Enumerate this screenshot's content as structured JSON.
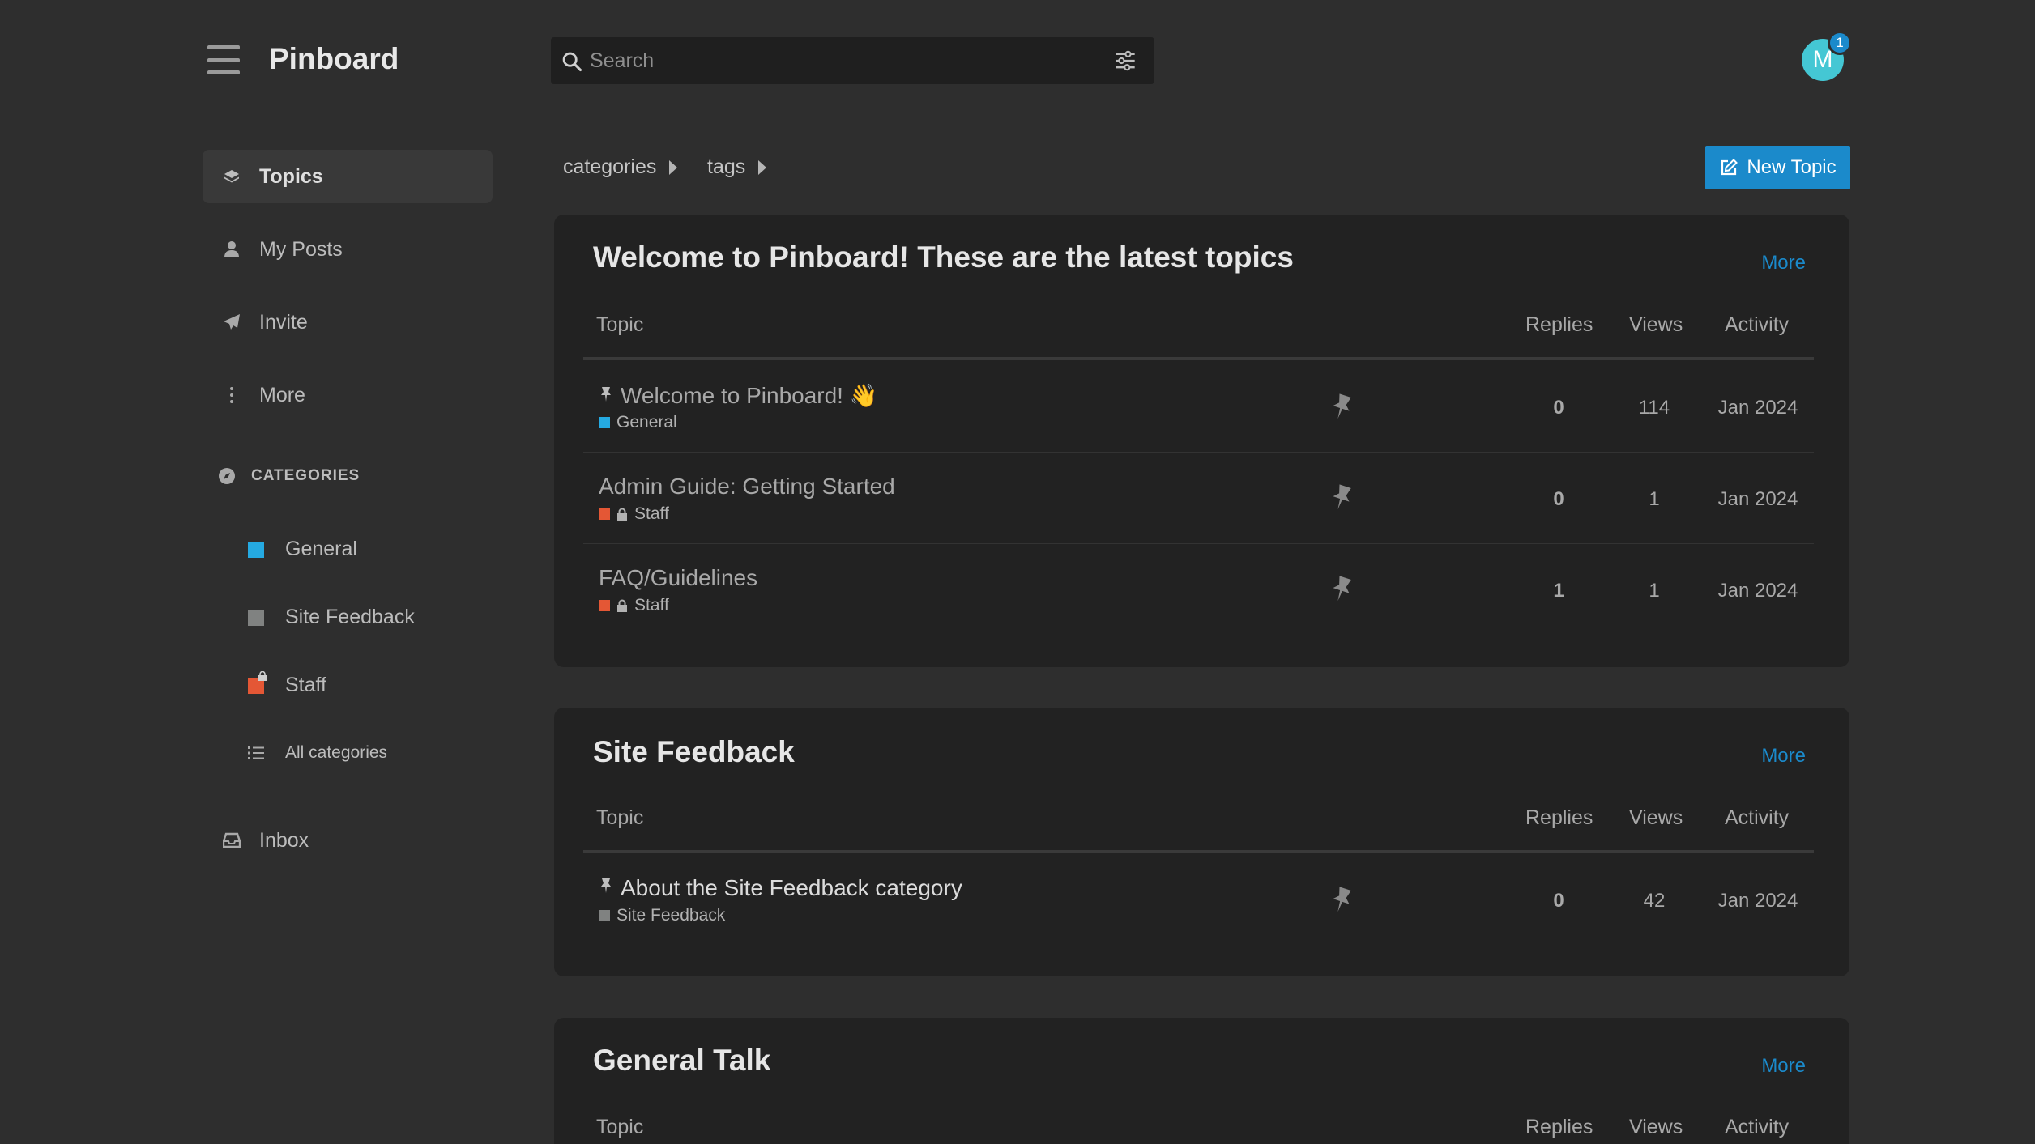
{
  "header": {
    "title": "Pinboard",
    "search_placeholder": "Search",
    "avatar_letter": "M",
    "notification_count": "1"
  },
  "sidebar": {
    "nav": [
      {
        "label": "Topics",
        "icon": "layers-icon"
      },
      {
        "label": "My Posts",
        "icon": "user-icon"
      },
      {
        "label": "Invite",
        "icon": "paper-plane-icon"
      },
      {
        "label": "More",
        "icon": "vertical-ellipsis-icon"
      }
    ],
    "categories_header": "CATEGORIES",
    "categories": [
      {
        "label": "General",
        "color": "#25aae2"
      },
      {
        "label": "Site Feedback",
        "color": "#808281"
      },
      {
        "label": "Staff",
        "color": "#e45735",
        "locked": true
      }
    ],
    "all_categories": "All categories",
    "inbox": "Inbox"
  },
  "filters": {
    "categories": "categories",
    "tags": "tags",
    "new_topic": "New Topic"
  },
  "columns": {
    "topic": "Topic",
    "replies": "Replies",
    "views": "Views",
    "activity": "Activity"
  },
  "sections": [
    {
      "title": "Welcome to Pinboard! These are the latest topics",
      "more": "More",
      "topics": [
        {
          "title": "Welcome to Pinboard! 👋",
          "category": "General",
          "replies": "0",
          "views": "114",
          "activity": "Jan 2024"
        },
        {
          "title": "Admin Guide: Getting Started",
          "category": "Staff",
          "replies": "0",
          "views": "1",
          "activity": "Jan 2024"
        },
        {
          "title": "FAQ/Guidelines",
          "category": "Staff",
          "replies": "1",
          "views": "1",
          "activity": "Jan 2024"
        }
      ]
    },
    {
      "title": "Site Feedback",
      "more": "More",
      "topics": [
        {
          "title": "About the Site Feedback category",
          "category": "Site Feedback",
          "replies": "0",
          "views": "42",
          "activity": "Jan 2024"
        }
      ]
    },
    {
      "title": "General Talk",
      "more": "More",
      "topics": []
    }
  ],
  "colors": {
    "accent": "#1b8acb",
    "general": "#25aae2",
    "site_feedback": "#808281",
    "staff": "#e45735"
  }
}
